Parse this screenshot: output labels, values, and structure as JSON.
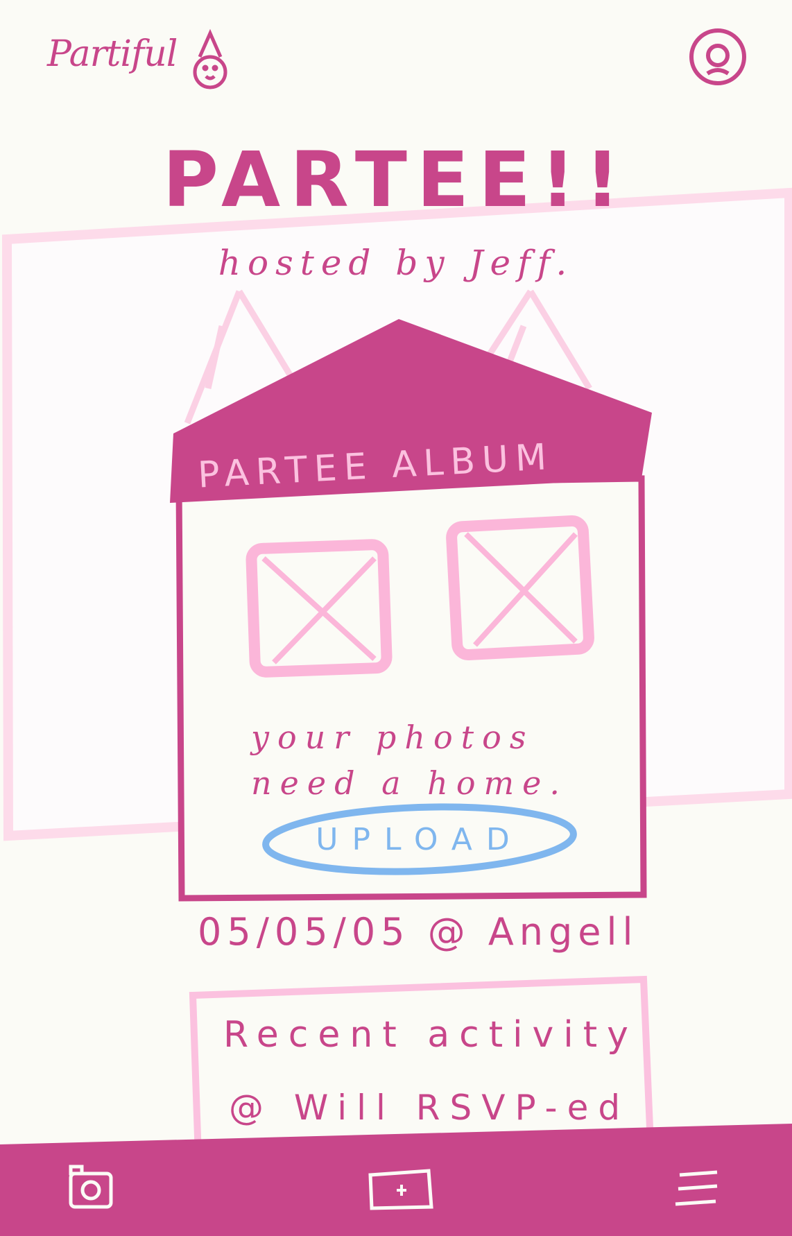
{
  "app": {
    "logo_text": "Partiful"
  },
  "header": {
    "profile_icon": "profile-search-icon"
  },
  "event": {
    "title": "PARTEE!!",
    "host_line": "hosted by Jeff.",
    "date_location": "05/05/05 @ Angell"
  },
  "album": {
    "title": "PARTEE ALBUM",
    "tagline_line1": "your photos",
    "tagline_line2": "need a home.",
    "upload_label": "UPLOAD",
    "photo_placeholder_icon": "image-placeholder-icon"
  },
  "activity": {
    "title": "Recent activity",
    "items": [
      {
        "text": "@ Will RSVP-ed"
      }
    ]
  },
  "nav": {
    "camera_icon": "camera-icon",
    "add_icon": "add-icon",
    "menu_icon": "menu-icon"
  },
  "colors": {
    "brand": "#c8468a",
    "light_pink": "#fbc1df",
    "upload_blue": "#7fb6ee",
    "background": "#fbfbf6"
  }
}
